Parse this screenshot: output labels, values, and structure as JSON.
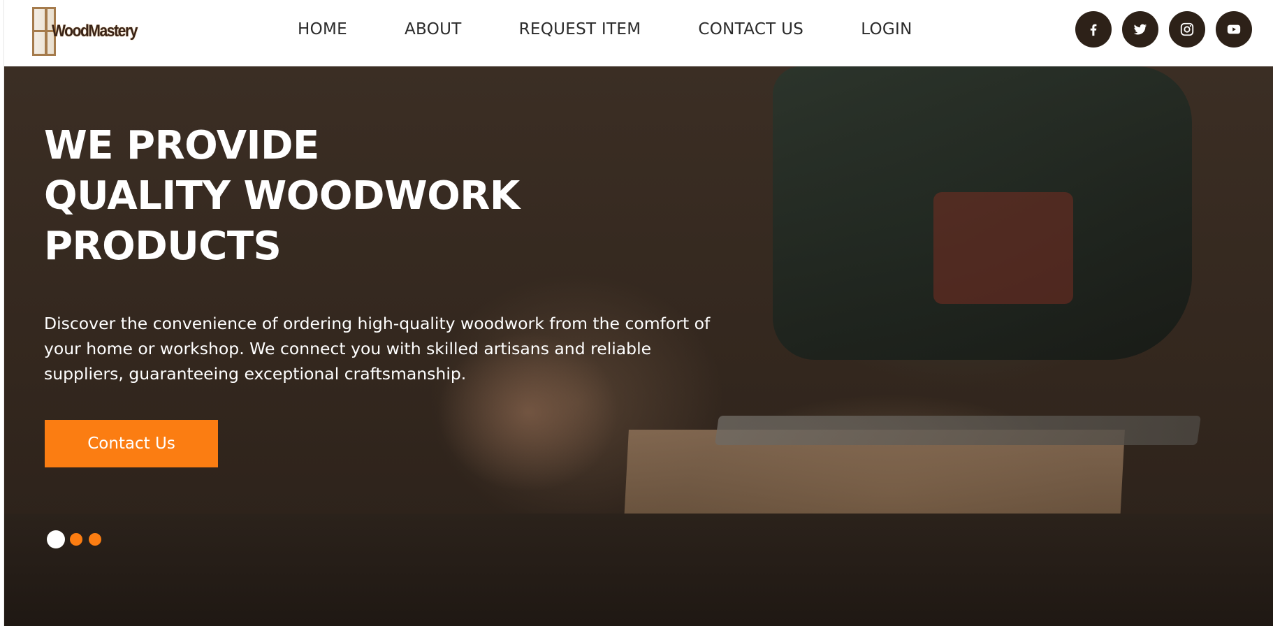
{
  "header": {
    "logo_text": "WoodMastery",
    "nav": [
      {
        "label": "HOME"
      },
      {
        "label": "ABOUT"
      },
      {
        "label": "REQUEST ITEM"
      },
      {
        "label": "CONTACT US"
      },
      {
        "label": "LOGIN"
      }
    ],
    "socials": [
      {
        "icon": "facebook-icon"
      },
      {
        "icon": "twitter-icon"
      },
      {
        "icon": "instagram-icon"
      },
      {
        "icon": "youtube-icon"
      }
    ]
  },
  "hero": {
    "title_lines": [
      "WE PROVIDE",
      "QUALITY WOODWORK",
      "PRODUCTS"
    ],
    "description_lines": [
      "Discover the convenience of ordering high-quality woodwork from the comfort of",
      "your home or workshop. We connect you with skilled artisans and reliable",
      "suppliers, guaranteeing exceptional craftsmanship."
    ],
    "cta_label": "Contact Us",
    "carousel": {
      "total": 3,
      "active_index": 0
    }
  },
  "colors": {
    "accent": "#fb7d12",
    "social_bg": "#2d2118",
    "nav_text": "#2b2b2b",
    "hero_text": "#ffffff"
  }
}
